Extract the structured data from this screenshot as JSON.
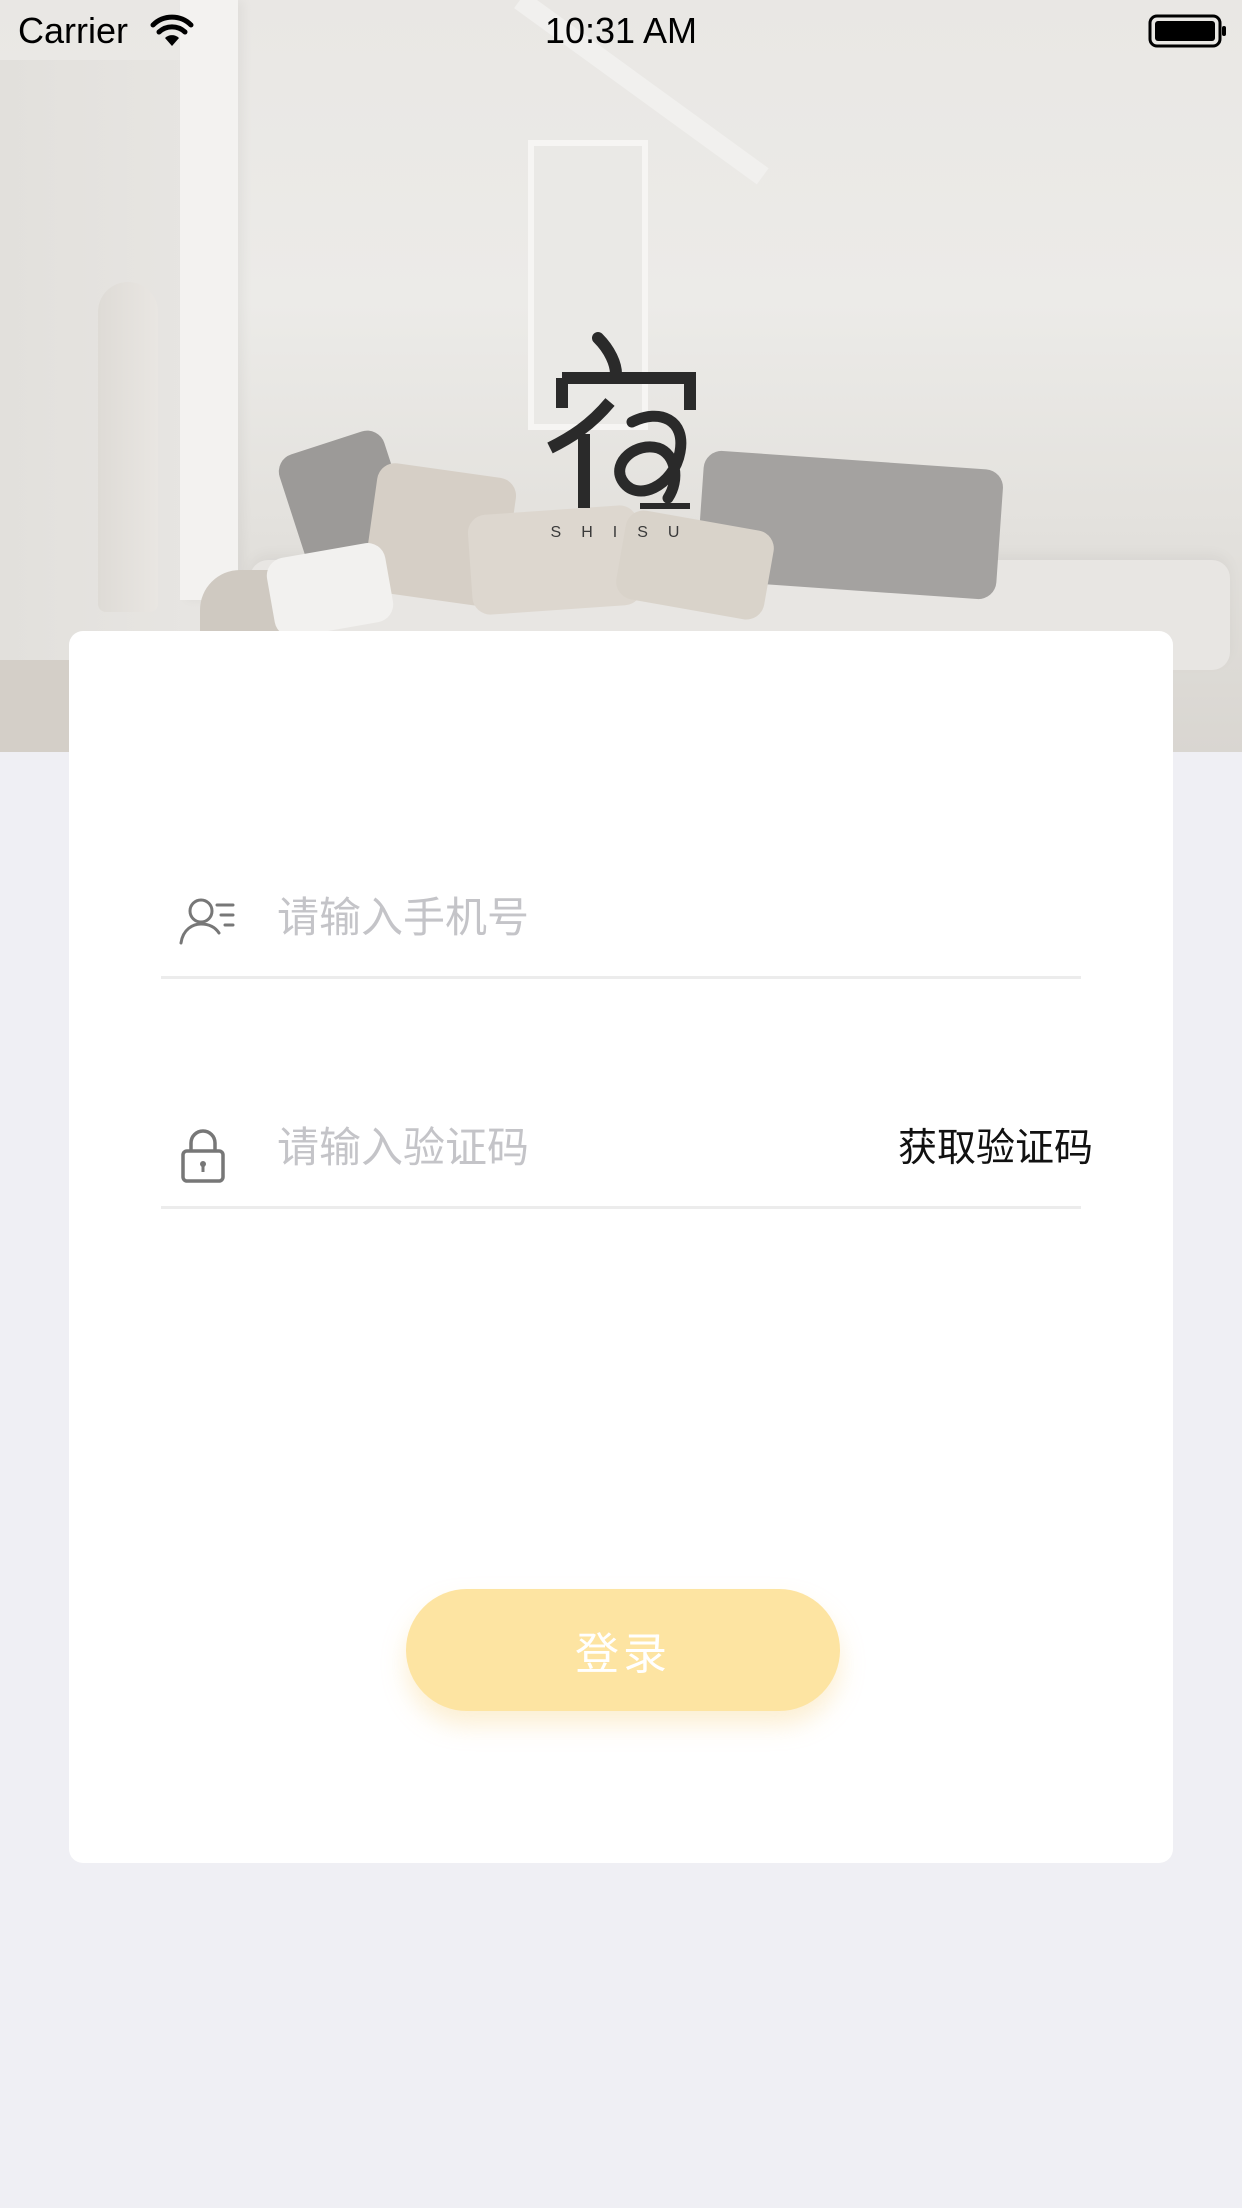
{
  "status_bar": {
    "carrier": "Carrier",
    "time": "10:31 AM",
    "wifi_icon": "wifi-icon",
    "battery_icon": "battery-icon"
  },
  "brand": {
    "logo_icon": "shisu-logo-icon",
    "logo_caption": "SHISU"
  },
  "form": {
    "phone": {
      "icon": "user-list-icon",
      "placeholder": "请输入手机号",
      "value": ""
    },
    "code": {
      "icon": "lock-icon",
      "placeholder": "请输入验证码",
      "value": "",
      "get_code_label": "获取验证码"
    },
    "login_label": "登录"
  },
  "colors": {
    "background": "#efeff4",
    "card": "#ffffff",
    "login_button": "#fde4a2",
    "placeholder": "#c4c4c8"
  }
}
